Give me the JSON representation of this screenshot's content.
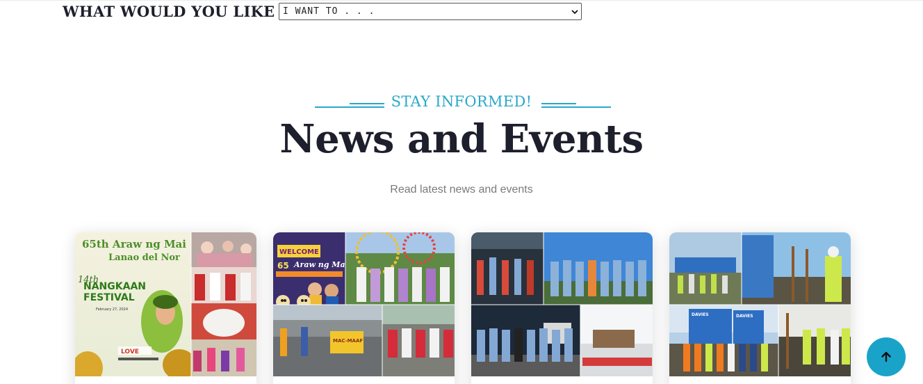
{
  "quick_nav": {
    "label": "WHAT WOULD YOU LIKE TO DO?",
    "select_value": "I WANT TO . . ."
  },
  "news_section": {
    "kicker": "STAY INFORMED!",
    "title": "News and Events",
    "subtitle": "Read latest news and events"
  },
  "news_cards": [
    {
      "poster_lines": [
        "65th Araw ng Mai",
        "Lanao del Nor",
        "14th",
        "NANGKAAN",
        "FESTIVAL",
        "February 27, 2024",
        "LOVE"
      ]
    },
    {
      "poster_lines": [
        "WELCOME",
        "65",
        "Araw ng Mai",
        "MAC-MAAF"
      ]
    },
    {
      "poster_lines": []
    },
    {
      "poster_lines": [
        "DAVIES",
        "DAVIES"
      ]
    }
  ],
  "colors": {
    "accent": "#29a8c9",
    "heading": "#1e1f2c",
    "muted": "#7a7a7a",
    "back_to_top": "#1aa3c9"
  },
  "icons": {
    "select_arrow": "chevron-down-icon",
    "back_to_top": "arrow-up-icon"
  }
}
